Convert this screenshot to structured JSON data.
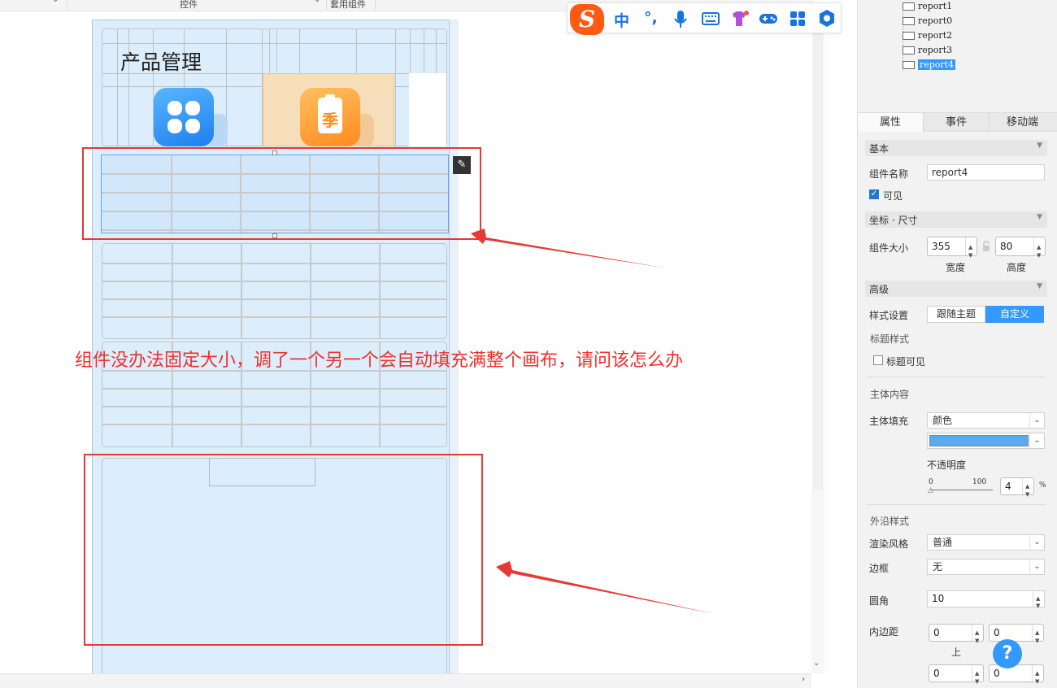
{
  "toolbar": {
    "controls_label": "控件",
    "template_widgets_label": "套用组件"
  },
  "canvas": {
    "title_widget_text": "产品管理",
    "orange_icon_char": "季"
  },
  "annotation": {
    "text": "组件没办法固定大小，调了一个另一个会自动填充满整个画布，请问该怎么办"
  },
  "ime_bar": {
    "logo": "S",
    "mode_label": "中",
    "punct_label": "°,"
  },
  "component_tree": {
    "items": [
      {
        "label": "report1",
        "selected": false
      },
      {
        "label": "report0",
        "selected": false
      },
      {
        "label": "report2",
        "selected": false
      },
      {
        "label": "report3",
        "selected": false
      },
      {
        "label": "report4",
        "selected": true
      }
    ]
  },
  "panel": {
    "tabs": [
      {
        "label": "属性",
        "active": true
      },
      {
        "label": "事件",
        "active": false
      },
      {
        "label": "移动端",
        "active": false
      }
    ],
    "basic": {
      "section_label": "基本",
      "name_label": "组件名称",
      "name_value": "report4",
      "visible_label": "可见",
      "visible_checked": true
    },
    "geometry": {
      "section_label": "坐标 · 尺寸",
      "size_label": "组件大小",
      "width_value": "355",
      "height_value": "80",
      "width_caption": "宽度",
      "height_caption": "高度"
    },
    "advanced": {
      "section_label": "高级",
      "style_label": "样式设置",
      "style_options": [
        "跟随主题",
        "自定义"
      ],
      "style_selected": "自定义",
      "title_style_label": "标题样式",
      "title_visible_label": "标题可见",
      "title_visible_checked": false,
      "body_content_label": "主体内容",
      "body_fill_label": "主体填充",
      "body_fill_value": "颜色",
      "fill_color": "#5aaaf0",
      "opacity_label": "不透明度",
      "opacity_min": "0",
      "opacity_max": "100",
      "opacity_value": "4",
      "opacity_unit": "%",
      "outer_style_label": "外沿样式",
      "render_style_label": "渲染风格",
      "render_style_value": "普通",
      "border_label": "边框",
      "border_value": "无",
      "radius_label": "圆角",
      "radius_value": "10",
      "padding_label": "内边距",
      "padding_top": "0",
      "padding_right": "0",
      "padding_bottom": "0",
      "padding_left": "0",
      "padding_top_caption": "上"
    },
    "help_label": "?"
  },
  "colors": {
    "accent": "#3399ff",
    "annotation_red": "#e53935",
    "canvas_blue": "#dcedfb"
  }
}
